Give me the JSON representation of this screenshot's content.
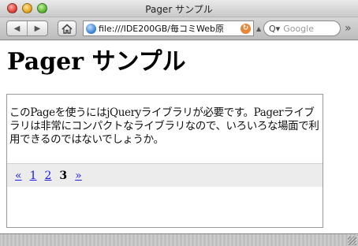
{
  "window": {
    "title": "Pager サンプル"
  },
  "toolbar": {
    "back_icon": "◀",
    "forward_icon": "▶",
    "home_icon": "home-icon",
    "url": "file:///IDE200GB/毎コミWeb原",
    "search_placeholder": "Google",
    "search_glyph": "Q▾",
    "overflow_glyph": "»"
  },
  "page": {
    "heading": "Pager サンプル",
    "pager_text": "このPageを使うにはjQueryライブラリが必要です。Pagerライブラリは非常にコンパクトなライブラリなので、いろいろな場面で利用できるのではないでしょうか。",
    "pager_nav": {
      "prev": "«",
      "pages": [
        "1",
        "2"
      ],
      "current": "3",
      "next": "»"
    }
  }
}
